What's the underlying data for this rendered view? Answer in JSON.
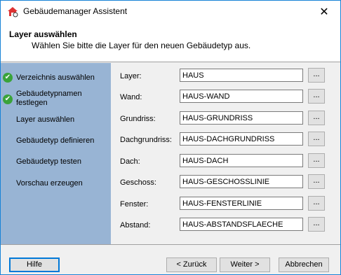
{
  "window": {
    "title": "Gebäudemanager Assistent",
    "close": "✕"
  },
  "header": {
    "title": "Layer auswählen",
    "subtitle": "Wählen Sie bitte die Layer für den neuen Gebäudetyp aus."
  },
  "steps": [
    {
      "label": "Verzeichnis auswählen",
      "done": true
    },
    {
      "label": "Gebäudetypnamen festlegen",
      "done": true
    },
    {
      "label": "Layer auswählen",
      "done": false
    },
    {
      "label": "Gebäudetyp definieren",
      "done": false
    },
    {
      "label": "Gebäudetyp testen",
      "done": false
    },
    {
      "label": "Vorschau erzeugen",
      "done": false
    }
  ],
  "fields": [
    {
      "label": "Layer:",
      "value": "HAUS"
    },
    {
      "label": "Wand:",
      "value": "HAUS-WAND"
    },
    {
      "label": "Grundriss:",
      "value": "HAUS-GRUNDRISS"
    },
    {
      "label": "Dachgrundriss:",
      "value": "HAUS-DACHGRUNDRISS"
    },
    {
      "label": "Dach:",
      "value": "HAUS-DACH"
    },
    {
      "label": "Geschoss:",
      "value": "HAUS-GESCHOSSLINIE"
    },
    {
      "label": "Fenster:",
      "value": "HAUS-FENSTERLINIE"
    },
    {
      "label": "Abstand:",
      "value": "HAUS-ABSTANDSFLAECHE"
    }
  ],
  "browse_label": "...",
  "buttons": {
    "help": "Hilfe",
    "back": "< Zurück",
    "next": "Weiter >",
    "cancel": "Abbrechen"
  }
}
